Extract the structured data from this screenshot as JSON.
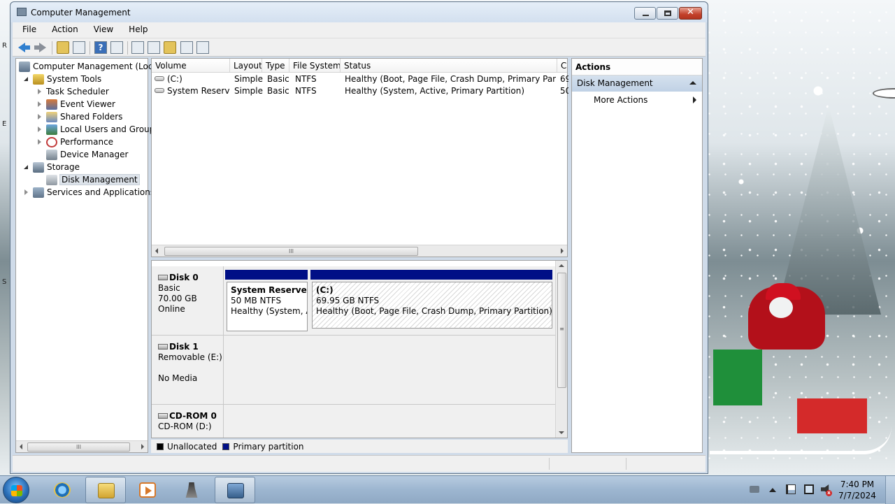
{
  "window": {
    "title": "Computer Management",
    "minimize": "",
    "maximize": "",
    "close": "✕"
  },
  "menu": [
    "File",
    "Action",
    "View",
    "Help"
  ],
  "toolbar": {
    "help_glyph": "?"
  },
  "tree": {
    "root": "Computer Management (Local",
    "system_tools": "System Tools",
    "task_scheduler": "Task Scheduler",
    "event_viewer": "Event Viewer",
    "shared_folders": "Shared Folders",
    "local_users": "Local Users and Groups",
    "performance": "Performance",
    "device_manager": "Device Manager",
    "storage": "Storage",
    "disk_management": "Disk Management",
    "services": "Services and Applications",
    "scroll_grip": "III"
  },
  "volumes": {
    "columns": [
      "Volume",
      "Layout",
      "Type",
      "File System",
      "Status",
      "C"
    ],
    "rows": [
      {
        "volume": "(C:)",
        "layout": "Simple",
        "type": "Basic",
        "fs": "NTFS",
        "status": "Healthy (Boot, Page File, Crash Dump, Primary Partition)",
        "cap": "69"
      },
      {
        "volume": "System Reserved",
        "layout": "Simple",
        "type": "Basic",
        "fs": "NTFS",
        "status": "Healthy (System, Active, Primary Partition)",
        "cap": "50"
      }
    ],
    "scroll_grip": "III"
  },
  "disks": {
    "disk0": {
      "name": "Disk 0",
      "type": "Basic",
      "size": "70.00 GB",
      "state": "Online",
      "partitions": [
        {
          "name": "System Reserved",
          "size": "50 MB NTFS",
          "status": "Healthy (System, Ac"
        },
        {
          "name": "(C:)",
          "size": "69.95 GB NTFS",
          "status": "Healthy (Boot, Page File, Crash Dump, Primary Partition)"
        }
      ]
    },
    "disk1": {
      "name": "Disk 1",
      "type": "Removable (E:)",
      "state": "No Media"
    },
    "cdrom0": {
      "name": "CD-ROM 0",
      "type": "CD-ROM (D:)"
    },
    "scroll_grip": "≡"
  },
  "legend": {
    "unallocated": "Unallocated",
    "primary": "Primary partition"
  },
  "actions": {
    "title": "Actions",
    "section": "Disk Management",
    "more": "More Actions"
  },
  "taskbar": {
    "time": "7:40 PM",
    "date": "7/7/2024"
  },
  "left_marks": [
    "R",
    "E",
    "S"
  ]
}
